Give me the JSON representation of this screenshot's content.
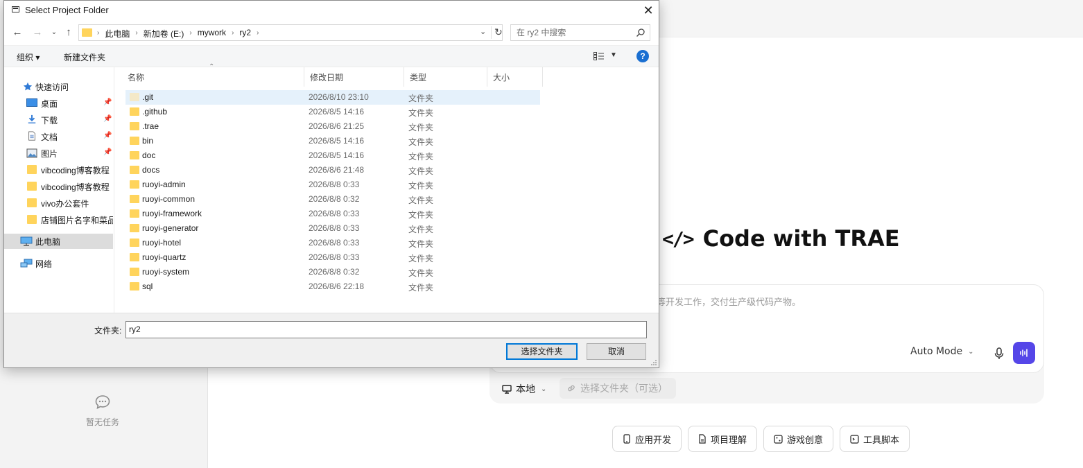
{
  "app": {
    "sidebar": {
      "empty_tasks_label": "暂无任务"
    },
    "hero": {
      "title": "Code with TRAE"
    },
    "composer": {
      "placeholder": "等开发工作，交付生产级代码产物。",
      "mode_label": "Auto Mode",
      "accent_color": "#5546e8"
    },
    "context_bar": {
      "local_label": "本地",
      "pick_folder_label": "选择文件夹（可选）"
    },
    "chips": [
      {
        "label": "应用开发",
        "icon": "phone-icon"
      },
      {
        "label": "项目理解",
        "icon": "document-icon"
      },
      {
        "label": "游戏创意",
        "icon": "dice-icon"
      },
      {
        "label": "工具脚本",
        "icon": "terminal-icon"
      }
    ]
  },
  "dialog": {
    "title": "Select Project Folder",
    "breadcrumbs": [
      "此电脑",
      "新加卷 (E:)",
      "mywork",
      "ry2"
    ],
    "search_placeholder": "在 ry2 中搜索",
    "toolbar": {
      "organize_label": "组织 ▾",
      "new_folder_label": "新建文件夹",
      "help_label": "?"
    },
    "nav": {
      "quick_access": "快速访问",
      "pinned": [
        {
          "label": "桌面",
          "icon": "desktop-icon"
        },
        {
          "label": "下载",
          "icon": "download-icon"
        },
        {
          "label": "文档",
          "icon": "documents-icon"
        },
        {
          "label": "图片",
          "icon": "pictures-icon"
        }
      ],
      "recent": [
        {
          "label": "vibcoding博客教程"
        },
        {
          "label": "vibcoding博客教程"
        },
        {
          "label": "vivo办公套件"
        },
        {
          "label": "店铺图片名字和菜品"
        }
      ],
      "this_pc": "此电脑",
      "network": "网络"
    },
    "columns": {
      "name": "名称",
      "modified": "修改日期",
      "type": "类型",
      "size": "大小"
    },
    "files": [
      {
        "name": ".git",
        "modified": "2026/8/10 23:10",
        "type": "文件夹"
      },
      {
        "name": ".github",
        "modified": "2026/8/5 14:16",
        "type": "文件夹"
      },
      {
        "name": ".trae",
        "modified": "2026/8/6 21:25",
        "type": "文件夹"
      },
      {
        "name": "bin",
        "modified": "2026/8/5 14:16",
        "type": "文件夹"
      },
      {
        "name": "doc",
        "modified": "2026/8/5 14:16",
        "type": "文件夹"
      },
      {
        "name": "docs",
        "modified": "2026/8/6 21:48",
        "type": "文件夹"
      },
      {
        "name": "ruoyi-admin",
        "modified": "2026/8/8 0:33",
        "type": "文件夹"
      },
      {
        "name": "ruoyi-common",
        "modified": "2026/8/8 0:32",
        "type": "文件夹"
      },
      {
        "name": "ruoyi-framework",
        "modified": "2026/8/8 0:33",
        "type": "文件夹"
      },
      {
        "name": "ruoyi-generator",
        "modified": "2026/8/8 0:33",
        "type": "文件夹"
      },
      {
        "name": "ruoyi-hotel",
        "modified": "2026/8/8 0:33",
        "type": "文件夹"
      },
      {
        "name": "ruoyi-quartz",
        "modified": "2026/8/8 0:33",
        "type": "文件夹"
      },
      {
        "name": "ruoyi-system",
        "modified": "2026/8/8 0:32",
        "type": "文件夹"
      },
      {
        "name": "sql",
        "modified": "2026/8/6 22:18",
        "type": "文件夹"
      }
    ],
    "folder_field": {
      "label": "文件夹:",
      "value": "ry2"
    },
    "buttons": {
      "select": "选择文件夹",
      "cancel": "取消"
    }
  }
}
